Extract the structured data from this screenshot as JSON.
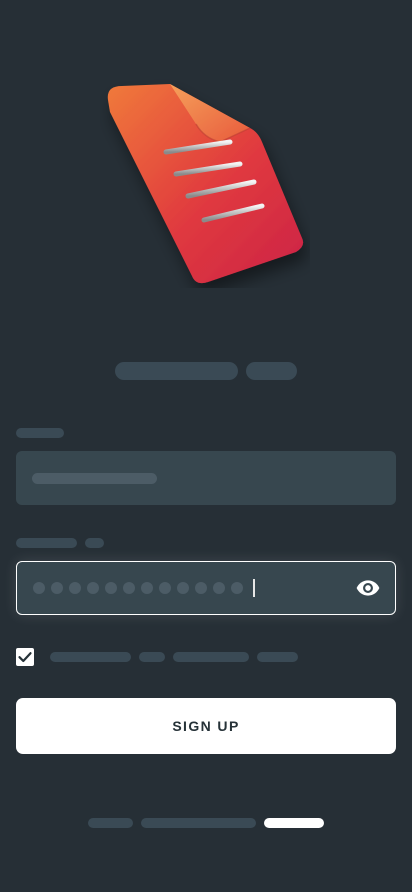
{
  "illustration": {
    "icon": "document-icon"
  },
  "password": {
    "masked_length": 12,
    "visibility_icon": "eye-icon"
  },
  "terms": {
    "checked": true
  },
  "signup": {
    "label": "SIGN UP"
  },
  "pager": {
    "pages": 3,
    "current": 3
  },
  "colors": {
    "background": "#262f36",
    "skeleton": "#3a4a55",
    "field": "#37474f",
    "button": "#ffffff",
    "button_text": "#263238",
    "accent_start": "#f07a3a",
    "accent_end": "#d42a4a"
  }
}
